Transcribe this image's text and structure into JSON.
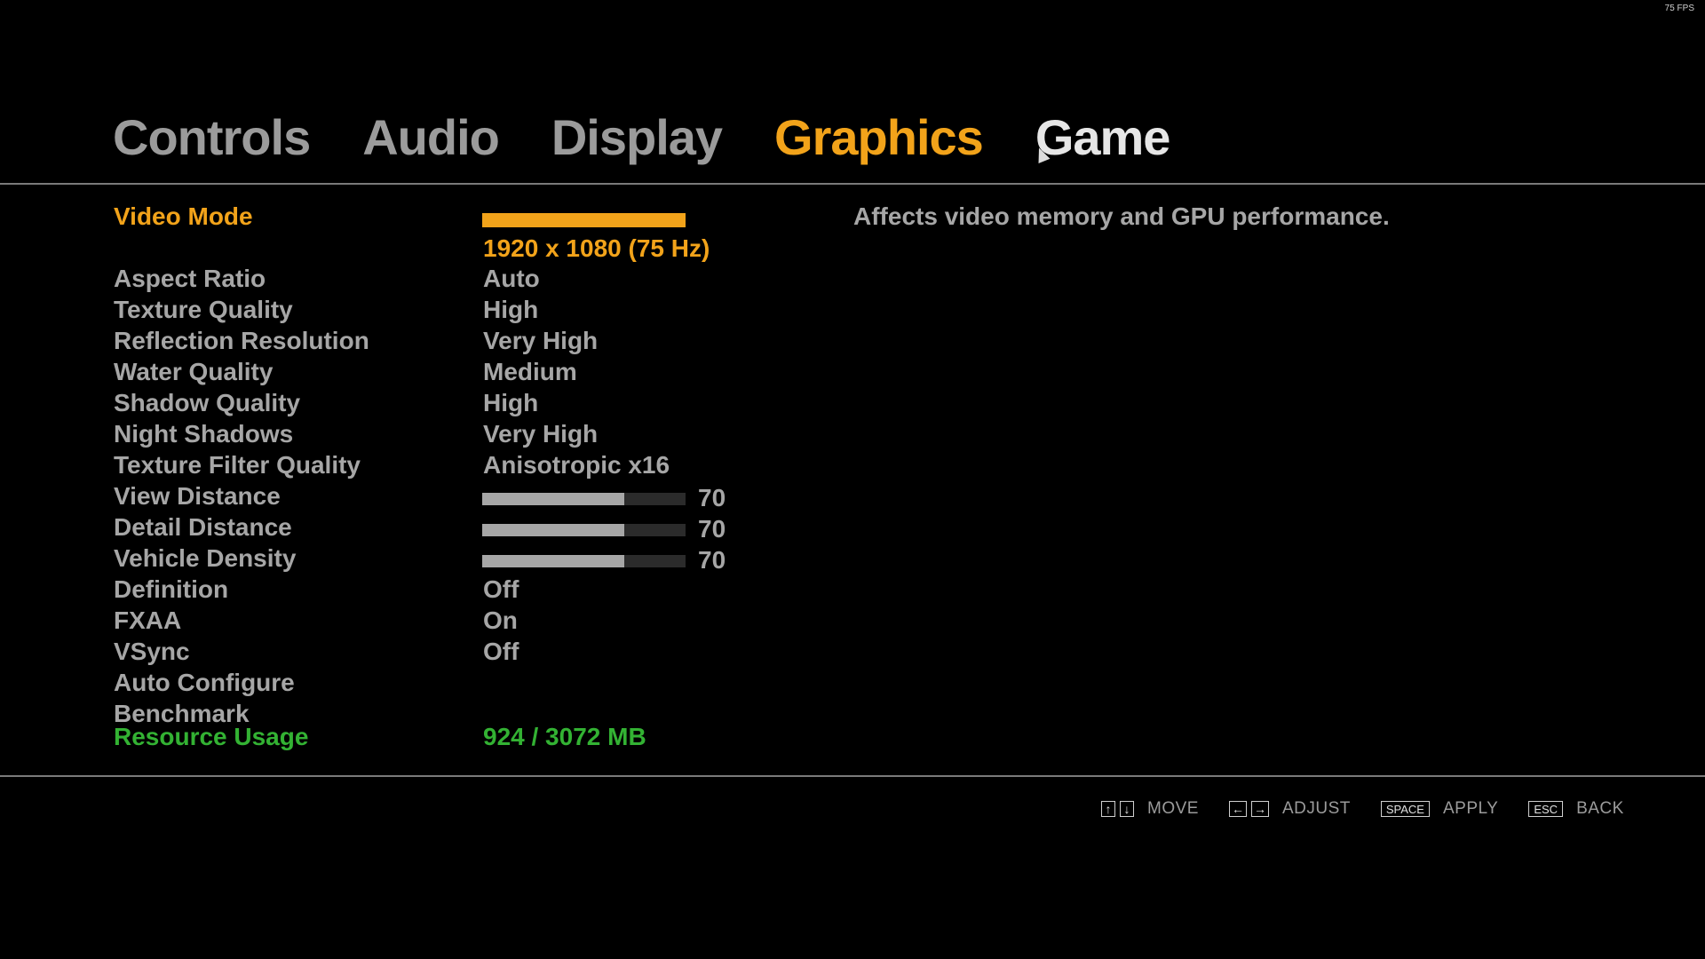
{
  "fps": "75 FPS",
  "tabs": [
    "Controls",
    "Audio",
    "Display",
    "Graphics",
    "Game"
  ],
  "video_mode": {
    "label": "Video Mode",
    "value": "1920 x 1080 (75 Hz)"
  },
  "settings": [
    {
      "label": "Aspect Ratio",
      "value": "Auto"
    },
    {
      "label": "Texture Quality",
      "value": "High"
    },
    {
      "label": "Reflection Resolution",
      "value": "Very High"
    },
    {
      "label": "Water Quality",
      "value": "Medium"
    },
    {
      "label": "Shadow Quality",
      "value": "High"
    },
    {
      "label": "Night Shadows",
      "value": "Very High"
    },
    {
      "label": "Texture Filter Quality",
      "value": "Anisotropic x16"
    }
  ],
  "sliders": [
    {
      "label": "View Distance",
      "value": 70
    },
    {
      "label": "Detail Distance",
      "value": 70
    },
    {
      "label": "Vehicle Density",
      "value": 70
    }
  ],
  "toggles": [
    {
      "label": "Definition",
      "value": "Off"
    },
    {
      "label": "FXAA",
      "value": "On"
    },
    {
      "label": "VSync",
      "value": "Off"
    }
  ],
  "actions": {
    "auto_configure": "Auto Configure",
    "benchmark": "Benchmark"
  },
  "resource": {
    "label": "Resource Usage",
    "value": "924 / 3072 MB"
  },
  "description": "Affects video memory and GPU performance.",
  "hints": {
    "move_label": "MOVE",
    "adjust_label": "ADJUST",
    "apply_key": "SPACE",
    "apply_label": "APPLY",
    "back_key": "ESC",
    "back_label": "BACK"
  },
  "colors": {
    "accent": "#f2a31a",
    "text": "#a6a6a6",
    "resource": "#33b233",
    "background": "#000000"
  }
}
